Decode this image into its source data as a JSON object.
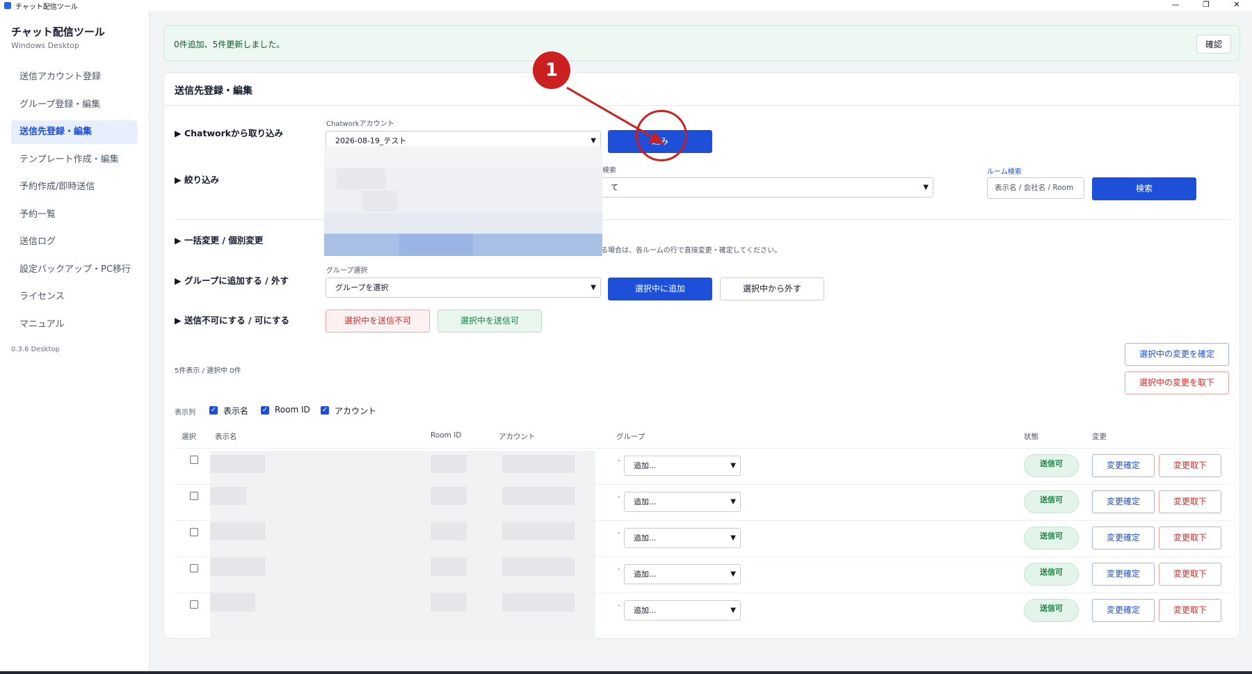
{
  "window": {
    "title": "チャット配信ツール",
    "controls": [
      "—",
      "❐",
      "✕"
    ]
  },
  "sidebar": {
    "title": "チャット配信ツール",
    "subtitle": "Windows Desktop",
    "items": [
      {
        "label": "送信アカウント登録"
      },
      {
        "label": "グループ登録・編集"
      },
      {
        "label": "送信先登録・編集",
        "active": true
      },
      {
        "label": "テンプレート作成・編集"
      },
      {
        "label": "予約作成/即時送信"
      },
      {
        "label": "予約一覧"
      },
      {
        "label": "送信ログ"
      },
      {
        "label": "設定バックアップ・PC移行"
      },
      {
        "label": "ライセンス"
      },
      {
        "label": "マニュアル"
      }
    ],
    "version": "0.3.6 Desktop"
  },
  "notice": {
    "text": "0件追加、5件更新しました。",
    "confirm_label": "確認"
  },
  "panel": {
    "title": "送信先登録・編集",
    "import": {
      "section_label": "▶ Chatworkから取り込み",
      "account_label": "Chatworkアカウント",
      "account_value": "2026-08-19_テスト",
      "button_label": "込み"
    },
    "filter": {
      "section_label": "▶ 絞り込み",
      "select_label": "検索",
      "select_value": "て",
      "room_search_label": "ルーム検索",
      "room_search_placeholder": "表示名 / 会社名 / Room",
      "search_button": "検索"
    },
    "bulk": {
      "section_label": "▶ 一括変更 / 個別変更",
      "hint": "る場合は、各ルームの行で直接変更・確定してください。"
    },
    "group": {
      "section_label": "▶ グループに追加する / 外す",
      "select_label": "グループ選択",
      "select_value": "グループを選択",
      "add_button": "選択中に追加",
      "remove_button": "選択中から外す"
    },
    "send_status": {
      "section_label": "▶ 送信不可にする / 可にする",
      "disable_button": "選択中を送信不可",
      "enable_button": "選択中を送信可"
    },
    "confirm_selected": "選択中の変更を確定",
    "revert_selected": "選択中の変更を取下",
    "count_text": "5件表示 / 選択中 0件",
    "columns_label": "表示列",
    "column_toggles": [
      {
        "label": "表示名",
        "checked": true
      },
      {
        "label": "Room ID",
        "checked": true
      },
      {
        "label": "アカウント",
        "checked": true
      }
    ],
    "table": {
      "headers": {
        "select": "選択",
        "name": "表示名",
        "room_id": "Room ID",
        "account": "アカウント",
        "group": "グループ",
        "status": "状態",
        "change": "変更"
      },
      "rows": [
        {
          "group_current": "-",
          "group_select": "追加...",
          "status": "送信可",
          "confirm": "変更確定",
          "revert": "変更取下"
        },
        {
          "group_current": "-",
          "group_select": "追加...",
          "status": "送信可",
          "confirm": "変更確定",
          "revert": "変更取下"
        },
        {
          "group_current": "-",
          "group_select": "追加...",
          "status": "送信可",
          "confirm": "変更確定",
          "revert": "変更取下"
        },
        {
          "group_current": "-",
          "group_select": "追加...",
          "status": "送信可",
          "confirm": "変更確定",
          "revert": "変更取下"
        },
        {
          "group_current": "-",
          "group_select": "追加...",
          "status": "送信可",
          "confirm": "変更確定",
          "revert": "変更取下"
        }
      ]
    }
  },
  "annotation": {
    "badge": "1",
    "color": "#cc1f1f"
  }
}
